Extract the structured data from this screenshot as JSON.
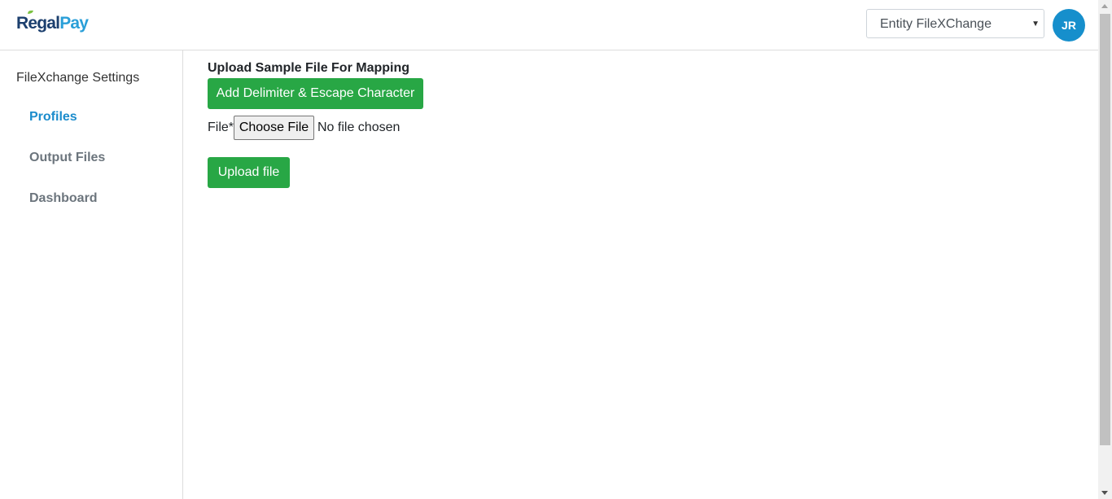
{
  "header": {
    "logo_regal": "Regal",
    "logo_pay": "Pay",
    "entity_select": {
      "selected": "Entity FileXChange"
    },
    "avatar_initials": "JR"
  },
  "sidebar": {
    "title": "FileXchange Settings",
    "items": [
      {
        "label": "Profiles",
        "active": true
      },
      {
        "label": "Output Files",
        "active": false
      },
      {
        "label": "Dashboard",
        "active": false
      }
    ]
  },
  "main": {
    "section_title": "Upload Sample File For Mapping",
    "delimiter_button_label": "Add Delimiter & Escape Character",
    "file_field": {
      "label": "File*",
      "choose_button_label": "Choose File",
      "status_text": "No file chosen"
    },
    "upload_button_label": "Upload file"
  },
  "colors": {
    "accent_green": "#28a745",
    "brand_blue": "#1b8ccc",
    "avatar_bg": "#168fcc",
    "logo_dark": "#1c3f6e"
  },
  "icons": [
    "chevron-down-icon",
    "leaf-icon"
  ]
}
